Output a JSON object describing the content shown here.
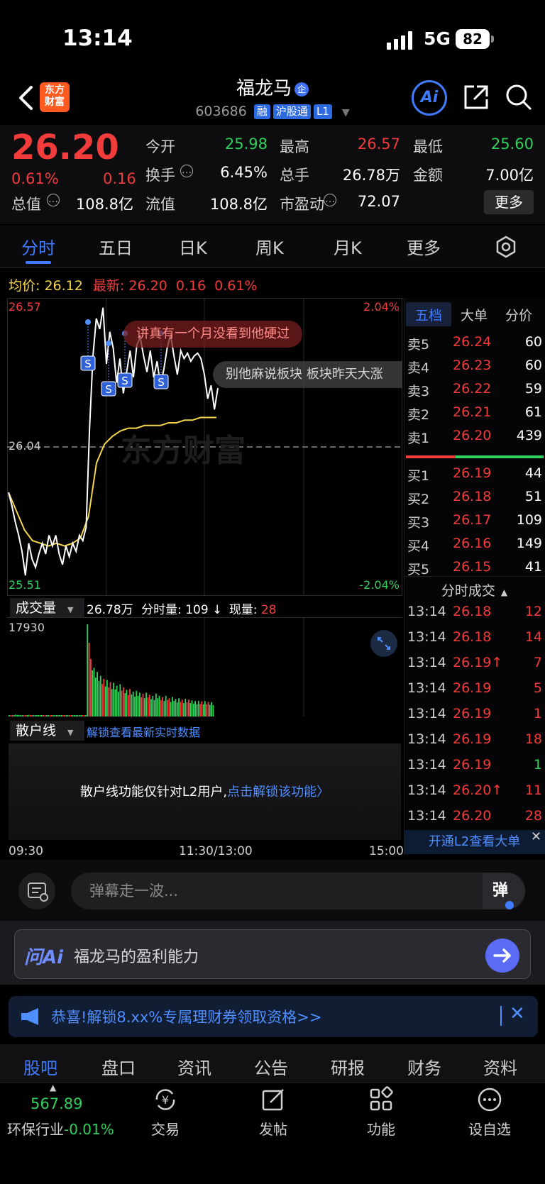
{
  "status_bar": {
    "time": "13:14",
    "network": "5G",
    "battery": "82"
  },
  "header": {
    "logo_line1": "东方",
    "logo_line2": "财富",
    "stock_name": "福龙马",
    "corp_badge": "企",
    "stock_code": "603686",
    "tags": [
      "融",
      "沪股通",
      "L1"
    ],
    "ai_label": "Ai"
  },
  "quote": {
    "price": "26.20",
    "change_pct": "0.61%",
    "change_val": "0.16",
    "fields": [
      {
        "label": "今开",
        "value": "25.98",
        "color": "green"
      },
      {
        "label": "最高",
        "value": "26.57",
        "color": "red"
      },
      {
        "label": "最低",
        "value": "25.60",
        "color": "green"
      },
      {
        "label": "换手",
        "value": "6.45%",
        "color": "white"
      },
      {
        "label": "总手",
        "value": "26.78万",
        "color": "white"
      },
      {
        "label": "金额",
        "value": "7.00亿",
        "color": "white"
      },
      {
        "label": "总值",
        "value": "108.8亿",
        "color": "white"
      },
      {
        "label": "流值",
        "value": "108.8亿",
        "color": "white"
      },
      {
        "label": "市盈动",
        "value": "72.07",
        "color": "white"
      }
    ],
    "more_label": "更多"
  },
  "chart_tabs": [
    "分时",
    "五日",
    "日K",
    "周K",
    "月K",
    "更多"
  ],
  "avg_row": {
    "avg_label": "均价:",
    "avg_value": "26.12",
    "latest_label": "最新:",
    "latest_value": "26.20",
    "latest_change": "0.16",
    "latest_pct": "0.61%"
  },
  "chart_labels": {
    "high": "26.57",
    "high_pct": "2.04%",
    "mid": "26.04",
    "low": "25.51",
    "low_pct": "-2.04%",
    "watermark": "东方财富",
    "comment1": "讲真有一个月没看到他硬过",
    "comment2": "别他麻说板块   板块昨天大涨",
    "sell_marker": "S"
  },
  "volume": {
    "title": "成交量",
    "total": "26.78万",
    "period_label": "分时量: 109 ↓",
    "current_label": "现量:",
    "current_value": "28",
    "max": "17930"
  },
  "retail": {
    "title": "散户线",
    "unlock_link": "解锁查看最新实时数据",
    "message": "散户线功能仅针对L2用户,",
    "message_link": "点击解锁该功能〉"
  },
  "time_axis": {
    "start": "09:30",
    "mid": "11:30/13:00",
    "end": "15:00"
  },
  "book": {
    "tabs": [
      "五档",
      "大单",
      "分价"
    ],
    "asks": [
      {
        "label": "卖5",
        "price": "26.24",
        "vol": "60"
      },
      {
        "label": "卖4",
        "price": "26.23",
        "vol": "60"
      },
      {
        "label": "卖3",
        "price": "26.22",
        "vol": "59"
      },
      {
        "label": "卖2",
        "price": "26.21",
        "vol": "61"
      },
      {
        "label": "卖1",
        "price": "26.20",
        "vol": "439"
      }
    ],
    "bids": [
      {
        "label": "买1",
        "price": "26.19",
        "vol": "44"
      },
      {
        "label": "买2",
        "price": "26.18",
        "vol": "51"
      },
      {
        "label": "买3",
        "price": "26.17",
        "vol": "109"
      },
      {
        "label": "买4",
        "price": "26.16",
        "vol": "149"
      },
      {
        "label": "买5",
        "price": "26.15",
        "vol": "41"
      }
    ],
    "trades_title": "分时成交",
    "trades": [
      {
        "time": "13:14",
        "price": "26.18",
        "vol": "12",
        "color": "red"
      },
      {
        "time": "13:14",
        "price": "26.18",
        "vol": "14",
        "color": "red"
      },
      {
        "time": "13:14",
        "price": "26.19↑",
        "vol": "7",
        "color": "red"
      },
      {
        "time": "13:14",
        "price": "26.19",
        "vol": "5",
        "color": "red"
      },
      {
        "time": "13:14",
        "price": "26.19",
        "vol": "1",
        "color": "red"
      },
      {
        "time": "13:14",
        "price": "26.19",
        "vol": "18",
        "color": "red"
      },
      {
        "time": "13:14",
        "price": "26.19",
        "vol": "1",
        "color": "green"
      },
      {
        "time": "13:14",
        "price": "26.20↑",
        "vol": "11",
        "color": "red"
      },
      {
        "time": "13:14",
        "price": "26.20",
        "vol": "28",
        "color": "red"
      }
    ],
    "l2_banner": "开通L2查看大单"
  },
  "danmu": {
    "placeholder": "弹幕走一波...",
    "button": "弹"
  },
  "ai_ask": {
    "logo": "问Ai",
    "prompt": "福龙马的盈利能力"
  },
  "promo": {
    "text": "恭喜!解锁8.xx%专属理财券领取资格>>"
  },
  "bottom_tabs": [
    "股吧",
    "盘口",
    "资讯",
    "公告",
    "研报",
    "财务",
    "资料"
  ],
  "bottom_nav": {
    "index_value": "567.89",
    "index_label": "环保行业",
    "index_change": "-0.01%",
    "items": [
      "交易",
      "发帖",
      "功能",
      "设自选"
    ]
  },
  "colors": {
    "up": "#f23c3c",
    "down": "#2fd15c",
    "accent": "#3f7cff",
    "avg_line": "#f5d64b"
  },
  "chart_data": {
    "type": "line",
    "title": "",
    "ylim": [
      25.51,
      26.57
    ],
    "ref_price": 26.04,
    "series": [
      {
        "values": [
          25.87,
          25.82,
          25.76,
          25.71,
          25.65,
          25.56,
          25.68,
          25.62,
          25.59,
          25.64,
          25.68,
          25.64,
          25.71,
          25.67,
          25.71,
          25.64,
          25.6,
          25.67,
          25.63,
          25.68,
          25.65,
          25.71,
          25.69,
          25.74,
          26.11,
          26.38,
          26.52,
          26.48,
          26.56,
          26.35,
          26.47,
          26.41,
          26.28,
          26.37,
          26.24,
          26.32,
          26.4,
          26.3,
          26.42,
          26.45,
          26.38,
          26.32,
          26.4,
          26.3,
          26.36,
          26.27,
          26.33,
          26.41,
          26.46,
          26.38,
          26.31,
          26.4,
          26.37,
          26.39,
          26.36,
          26.38,
          26.39,
          26.37,
          26.31,
          26.22,
          26.27,
          26.18,
          26.26
        ]
      },
      {
        "values": [
          25.87,
          25.8,
          25.73,
          25.69,
          25.68,
          25.67,
          25.68,
          25.67,
          25.68,
          25.7,
          25.78,
          25.98,
          26.05,
          26.08,
          26.1,
          26.11,
          26.11,
          26.12,
          26.12,
          26.12,
          26.13,
          26.13,
          26.14,
          26.14,
          26.15,
          26.15,
          26.15
        ]
      }
    ],
    "volume": [
      8,
      12,
      20,
      14,
      10,
      7,
      15,
      9,
      11,
      6,
      8,
      13,
      10,
      7,
      9,
      5,
      6,
      8,
      7,
      9,
      6,
      5,
      7,
      10,
      17930,
      7000,
      5000,
      4200,
      3500,
      3000,
      2800,
      2500,
      2400,
      2000,
      2200,
      1800,
      1500,
      1600,
      1300,
      1400,
      1200,
      1100,
      1200,
      1000,
      900,
      1100,
      900,
      800,
      900,
      700,
      800,
      650,
      700,
      600,
      650,
      600,
      550,
      500,
      520,
      480,
      500,
      450,
      430
    ]
  }
}
